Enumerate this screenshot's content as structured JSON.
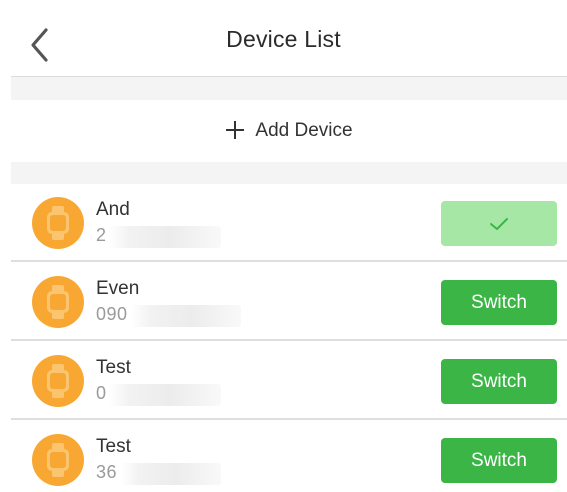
{
  "header": {
    "title": "Device List",
    "back_icon": "chevron-left-icon"
  },
  "add_device": {
    "label": "Add Device",
    "icon": "plus-icon"
  },
  "colors": {
    "accent_green": "#3cb547",
    "current_green": "#a6e7a6",
    "avatar_orange": "#f8a832"
  },
  "devices": [
    {
      "name": "And",
      "number": "2",
      "action": "",
      "state": "current",
      "icon": "check-icon"
    },
    {
      "name": "Even",
      "number": "090",
      "action": "Switch",
      "state": "available"
    },
    {
      "name": "Test",
      "number": "0",
      "action": "Switch",
      "state": "available"
    },
    {
      "name": "Test",
      "number": "36",
      "action": "Switch",
      "state": "available"
    }
  ]
}
